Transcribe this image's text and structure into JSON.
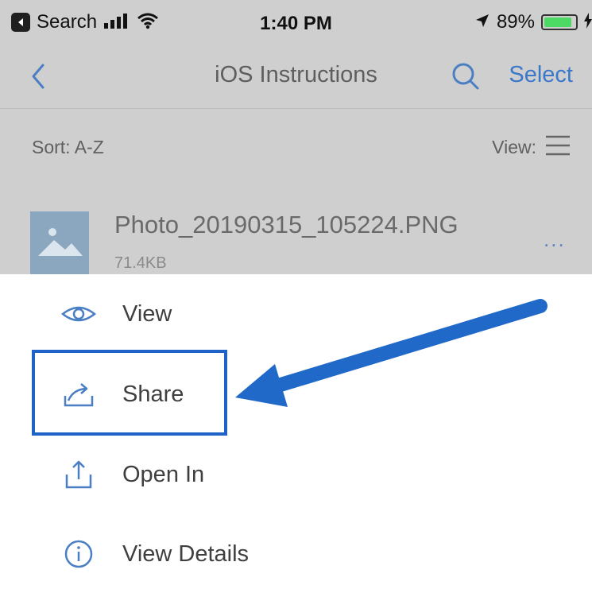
{
  "status_bar": {
    "back_app": "Search",
    "time": "1:40 PM",
    "battery_percent": "89%",
    "battery_level": 0.89,
    "icons": [
      "signal-bars-icon",
      "wifi-icon",
      "location-arrow-icon",
      "battery-icon"
    ]
  },
  "nav": {
    "title": "iOS Instructions",
    "select_label": "Select",
    "icons": [
      "back-chevron-icon",
      "search-icon"
    ]
  },
  "sort": {
    "sort_label": "Sort: A-Z",
    "view_label": "View:",
    "icons": [
      "list-view-icon"
    ]
  },
  "file": {
    "name": "Photo_20190315_105224.PNG",
    "size": "71.4KB",
    "more": "...",
    "icons": [
      "image-thumbnail-icon",
      "more-options-icon"
    ]
  },
  "actions": [
    {
      "label": "View",
      "icon": "eye-icon"
    },
    {
      "label": "Share",
      "icon": "share-icon"
    },
    {
      "label": "Open In",
      "icon": "upload-icon"
    },
    {
      "label": "View Details",
      "icon": "info-icon"
    }
  ],
  "colors": {
    "accent": "#3a78c9",
    "annotation": "#1f63c6",
    "dim_overlay": "#cfcfcf"
  },
  "annotation": {
    "highlighted_action": "Share",
    "icons": [
      "annotation-arrow",
      "highlight-box"
    ]
  }
}
